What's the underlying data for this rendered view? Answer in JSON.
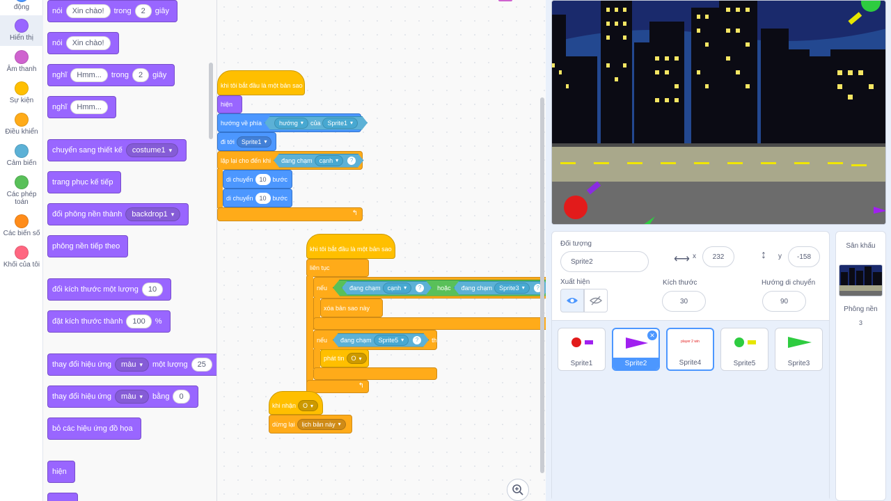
{
  "categories": [
    {
      "label": "động",
      "color": "#4c97ff"
    },
    {
      "label": "Hiển thị",
      "color": "#9966ff"
    },
    {
      "label": "Âm thanh",
      "color": "#cf63cf"
    },
    {
      "label": "Sự kiện",
      "color": "#ffbf00"
    },
    {
      "label": "Điều khiển",
      "color": "#ffab19"
    },
    {
      "label": "Cảm biến",
      "color": "#5cb1d6"
    },
    {
      "label": "Các phép toán",
      "color": "#59c059"
    },
    {
      "label": "Các biến số",
      "color": "#ff8c1a"
    },
    {
      "label": "Khối của tôi",
      "color": "#ff6680"
    }
  ],
  "palette": {
    "say_secs": {
      "say": "nói",
      "msg": "Xin chào!",
      "for": "trong",
      "secs": "2",
      "unit": "giây"
    },
    "say": {
      "say": "nói",
      "msg": "Xin chào!"
    },
    "think_secs": {
      "think": "nghĩ",
      "msg": "Hmm...",
      "for": "trong",
      "secs": "2",
      "unit": "giây"
    },
    "think": {
      "think": "nghĩ",
      "msg": "Hmm..."
    },
    "switch_costume": {
      "label": "chuyển sang thiết kế",
      "value": "costume1"
    },
    "next_costume": "trang phục kế tiếp",
    "switch_backdrop": {
      "label": "đổi phông nền thành",
      "value": "backdrop1"
    },
    "next_backdrop": "phông nền tiếp theo",
    "change_size": {
      "label": "đổi kích thước một lượng",
      "value": "10"
    },
    "set_size": {
      "label": "đặt kích thước thành",
      "value": "100",
      "unit": "%"
    },
    "change_effect": {
      "label": "thay đổi hiệu ứng",
      "effect": "màu",
      "by": "một lượng",
      "value": "25"
    },
    "set_effect": {
      "label": "thay đổi hiệu ứng",
      "effect": "màu",
      "to": "bằng",
      "value": "0"
    },
    "clear_effects": "bỏ các hiệu ứng đồ họa",
    "show": "hiện"
  },
  "script1": {
    "hat": "khi tôi bắt đầu là một bản sao",
    "show": "hiện",
    "point": {
      "label": "hướng về phía",
      "attr": "hướng",
      "of": "của",
      "sprite": "Sprite1"
    },
    "goto": {
      "label": "đi tới",
      "target": "Sprite1"
    },
    "repeat_until": {
      "label": "lặp lại cho đến khi",
      "touching": "đang chạm",
      "target": "cạnh"
    },
    "move1": {
      "label": "di chuyển",
      "value": "10",
      "unit": "bước"
    },
    "move2": {
      "label": "di chuyển",
      "value": "10",
      "unit": "bước"
    }
  },
  "script2": {
    "hat": "khi tôi bắt đầu là một bản sao",
    "forever": "liên tục",
    "if1": {
      "label": "nếu",
      "touching1": "đang chạm",
      "target1": "cạnh",
      "or": "hoặc",
      "touching2": "đang chạm",
      "target2": "Sprite3"
    },
    "delete": "xóa bản sao này",
    "if2": {
      "label": "nếu",
      "touching": "đang chạm",
      "target": "Sprite5",
      "then": "thì"
    },
    "broadcast": {
      "label": "phát tin",
      "msg": "O"
    }
  },
  "script3": {
    "hat": {
      "label": "khi nhận",
      "msg": "O"
    },
    "stop": {
      "label": "dừng lại",
      "option": "lịch bản này"
    }
  },
  "sprite_info": {
    "object_label": "Đối tượng",
    "name": "Sprite2",
    "x_label": "x",
    "x": "232",
    "y_label": "y",
    "y": "-158",
    "show_label": "Xuất hiện",
    "size_label": "Kích thước",
    "size": "30",
    "direction_label": "Hướng di chuyển",
    "direction": "90"
  },
  "sprites": [
    {
      "name": "Sprite1"
    },
    {
      "name": "Sprite2"
    },
    {
      "name": "Sprite4",
      "thumb_text": "player 2 win"
    },
    {
      "name": "Sprite5"
    },
    {
      "name": "Sprite3"
    }
  ],
  "backdrop_panel": {
    "title": "Sân khấu",
    "label": "Phông nền",
    "count": "3"
  }
}
